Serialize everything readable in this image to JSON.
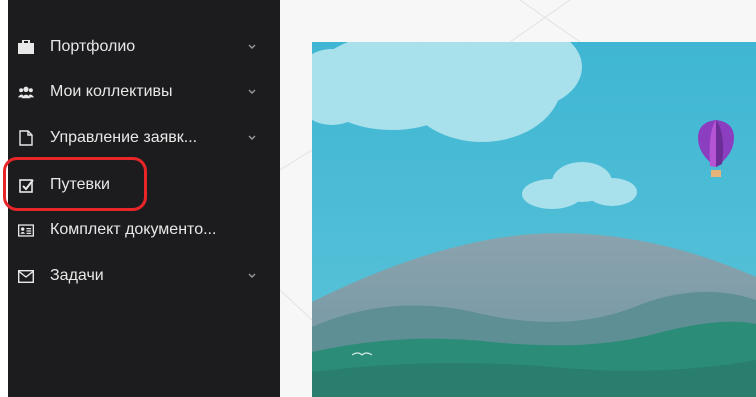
{
  "sidebar": {
    "items": [
      {
        "label": "Портфолио",
        "icon": "briefcase-icon",
        "has_chevron": true
      },
      {
        "label": "Мои коллективы",
        "icon": "users-icon",
        "has_chevron": true
      },
      {
        "label": "Управление заявк...",
        "icon": "file-icon",
        "has_chevron": true
      },
      {
        "label": "Путевки",
        "icon": "checkbox-icon",
        "has_chevron": false,
        "highlighted": true
      },
      {
        "label": "Комплект документо...",
        "icon": "id-card-icon",
        "has_chevron": false
      },
      {
        "label": "Задачи",
        "icon": "envelope-icon",
        "has_chevron": true
      }
    ]
  },
  "colors": {
    "sidebar_bg": "#1c1c1e",
    "sidebar_text": "#e8e8e8",
    "highlight": "#e8262a",
    "sky": "#46b8d2",
    "hills": "#2e8f7a"
  }
}
